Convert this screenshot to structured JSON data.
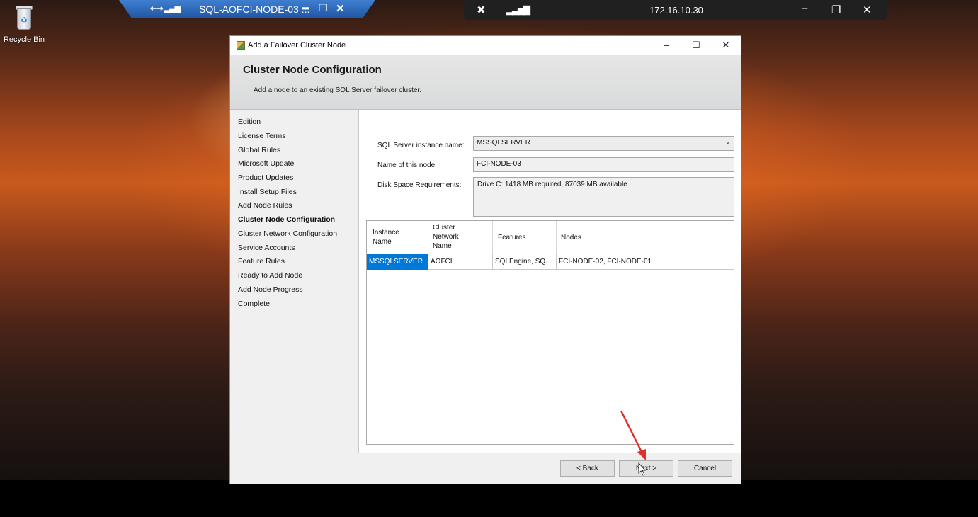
{
  "desktop": {
    "recycle_bin_label": "Recycle Bin"
  },
  "rdp_tab": {
    "title": "SQL-AOFCI-NODE-03 ..."
  },
  "rdp_bar": {
    "address": "172.16.10.30"
  },
  "window": {
    "title": "Add a Failover Cluster Node",
    "header_title": "Cluster Node Configuration",
    "header_subtitle": "Add a node to an existing SQL Server failover cluster."
  },
  "nav": {
    "items": [
      {
        "label": "Edition",
        "active": false
      },
      {
        "label": "License Terms",
        "active": false
      },
      {
        "label": "Global Rules",
        "active": false
      },
      {
        "label": "Microsoft Update",
        "active": false
      },
      {
        "label": "Product Updates",
        "active": false
      },
      {
        "label": "Install Setup Files",
        "active": false
      },
      {
        "label": "Add Node Rules",
        "active": false
      },
      {
        "label": "Cluster Node Configuration",
        "active": true
      },
      {
        "label": "Cluster Network Configuration",
        "active": false
      },
      {
        "label": "Service Accounts",
        "active": false
      },
      {
        "label": "Feature Rules",
        "active": false
      },
      {
        "label": "Ready to Add Node",
        "active": false
      },
      {
        "label": "Add Node Progress",
        "active": false
      },
      {
        "label": "Complete",
        "active": false
      }
    ]
  },
  "form": {
    "instance_label": "SQL Server instance name:",
    "instance_value": "MSSQLSERVER",
    "node_label": "Name of this node:",
    "node_value": "FCI-NODE-03",
    "disk_label": "Disk Space Requirements:",
    "disk_value": "Drive C: 1418 MB required, 87039 MB available"
  },
  "grid": {
    "columns": [
      "Instance\nName",
      "Cluster\nNetwork\nName",
      "Features",
      "Nodes"
    ],
    "col_lines": [
      [
        "Instance",
        "Name"
      ],
      [
        "Cluster",
        "Network",
        "Name"
      ],
      [
        "Features"
      ],
      [
        "Nodes"
      ]
    ],
    "rows": [
      [
        "MSSQLSERVER",
        "AOFCI",
        "SQLEngine, SQ...",
        "FCI-NODE-02, FCI-NODE-01"
      ]
    ]
  },
  "buttons": {
    "back": "< Back",
    "next": "Next >",
    "cancel": "Cancel"
  },
  "colors": {
    "selection": "#0078d7",
    "annotation_arrow": "#e0302a"
  }
}
